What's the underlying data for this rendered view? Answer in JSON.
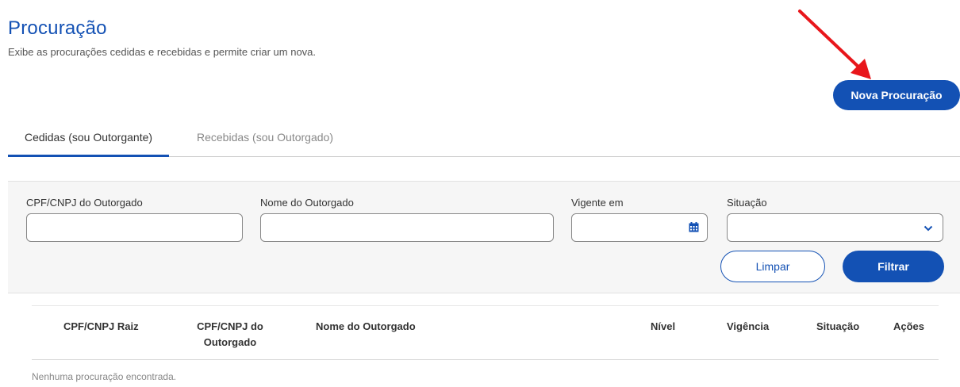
{
  "header": {
    "title": "Procuração",
    "subtitle": "Exibe as procurações cedidas e recebidas e permite criar um nova.",
    "new_button_label": "Nova Procuração"
  },
  "tabs": [
    {
      "label": "Cedidas (sou Outorgante)",
      "active": true
    },
    {
      "label": "Recebidas (sou Outorgado)",
      "active": false
    }
  ],
  "filters": {
    "cpf_cnpj_label": "CPF/CNPJ do Outorgado",
    "cpf_cnpj_value": "",
    "nome_label": "Nome do Outorgado",
    "nome_value": "",
    "vigente_label": "Vigente em",
    "vigente_value": "",
    "vigente_icon": "calendar-icon",
    "situacao_label": "Situação",
    "situacao_value": "",
    "situacao_icon": "chevron-down-icon",
    "clear_label": "Limpar",
    "filter_label": "Filtrar"
  },
  "table": {
    "columns": [
      "CPF/CNPJ Raiz",
      "CPF/CNPJ do Outorgado",
      "Nome do Outorgado",
      "Nível",
      "Vigência",
      "Situação",
      "Ações"
    ],
    "col_cpf_outorgado_line1": "CPF/CNPJ do",
    "col_cpf_outorgado_line2": "Outorgado",
    "empty_message": "Nenhuma procuração encontrada."
  },
  "colors": {
    "primary": "#1351b4",
    "annotation_arrow": "#e8161b",
    "panel_bg": "#f6f6f6"
  }
}
